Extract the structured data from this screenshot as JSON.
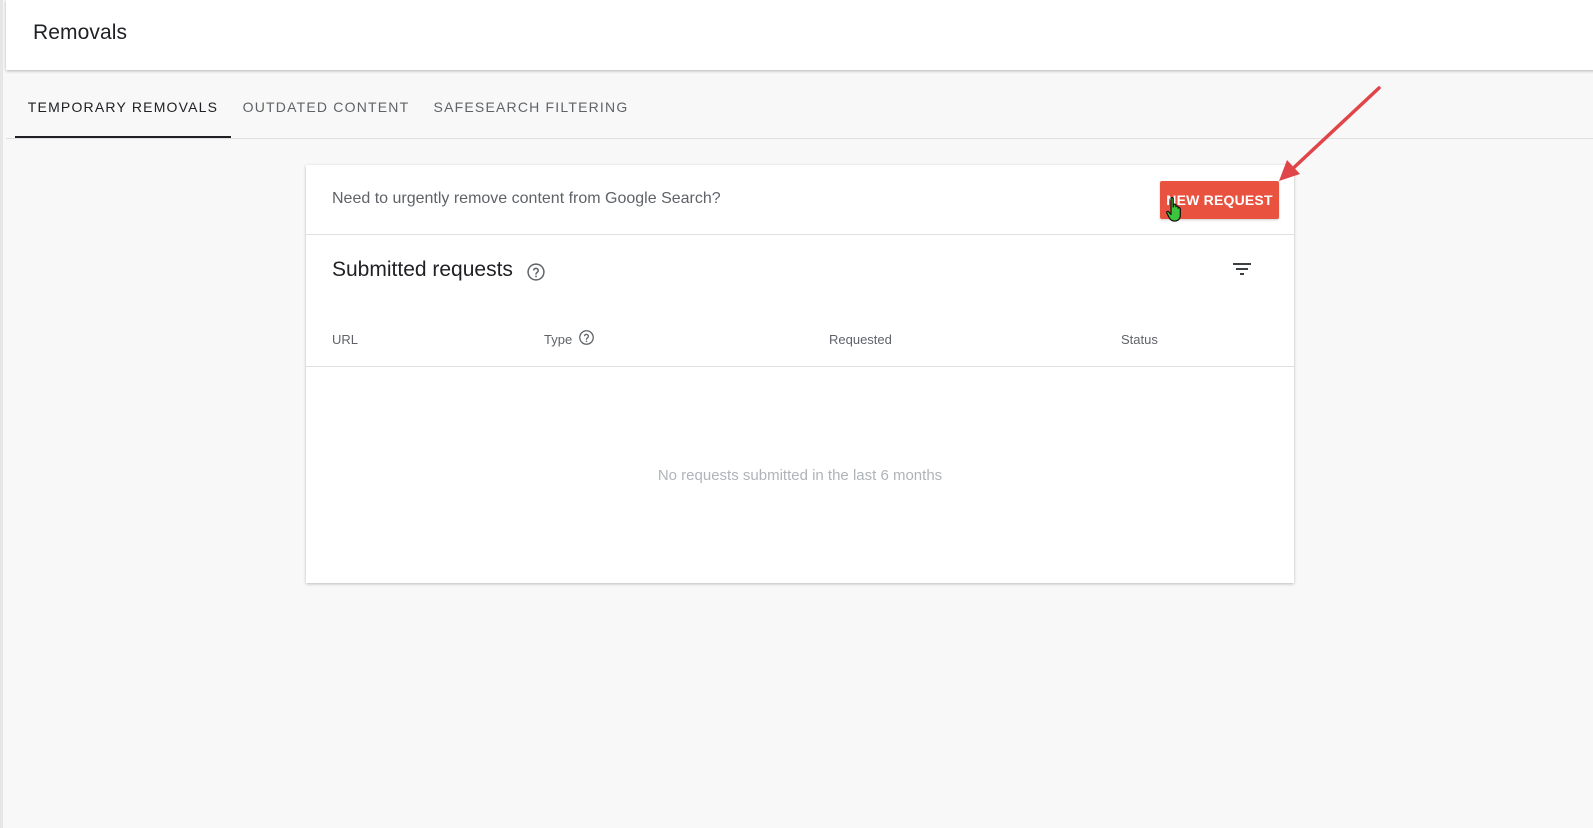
{
  "header": {
    "title": "Removals"
  },
  "tabs": [
    {
      "label": "Temporary removals",
      "active": true
    },
    {
      "label": "Outdated content",
      "active": false
    },
    {
      "label": "SafeSearch filtering",
      "active": false
    }
  ],
  "card": {
    "urgent_text": "Need to urgently remove content from Google Search?",
    "new_request_label": "New request",
    "section_title": "Submitted requests",
    "columns": {
      "url": "URL",
      "type": "Type",
      "requested": "Requested",
      "status": "Status"
    },
    "empty_message": "No requests submitted in the last 6 months"
  },
  "icons": {
    "help": "help-circle-icon",
    "filter": "filter-icon",
    "arrow": "annotation-arrow",
    "cursor": "hand-pointer-cursor"
  },
  "colors": {
    "accent": "#e8523f",
    "annotation": "#e0454a",
    "cursor_fill": "#3cc43c"
  }
}
